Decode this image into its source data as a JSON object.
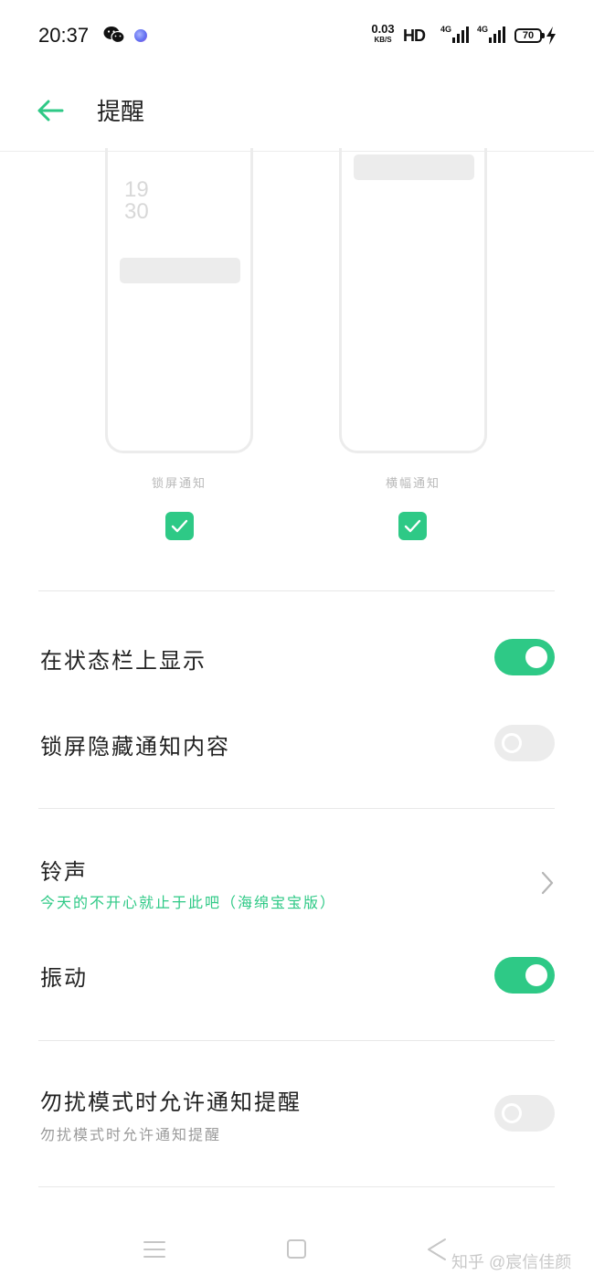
{
  "status_bar": {
    "time": "20:37",
    "net_speed_value": "0.03",
    "net_speed_unit": "KB/S",
    "hd": "HD",
    "signal_1": "4G",
    "signal_2": "4G",
    "battery": "70",
    "icons": [
      "wechat-icon",
      "assistant-icon",
      "signal-icon",
      "battery-icon",
      "charging-bolt-icon"
    ]
  },
  "header": {
    "title": "提醒",
    "back_icon": "arrow-left-icon"
  },
  "previews": {
    "lock_screen": {
      "clock_hour": "19",
      "clock_minute": "30",
      "caption": "锁屏通知",
      "checked": true
    },
    "banner": {
      "caption": "横幅通知",
      "checked": true
    }
  },
  "settings": [
    {
      "label": "在状态栏上显示",
      "toggle": true
    },
    {
      "label": "锁屏隐藏通知内容",
      "toggle": false
    },
    {
      "label": "铃声",
      "value": "今天的不开心就止于此吧（海绵宝宝版）",
      "chevron": true
    },
    {
      "label": "振动",
      "toggle": true
    },
    {
      "label": "勿扰模式时允许通知提醒",
      "sub": "勿扰模式时允许通知提醒",
      "toggle": false
    }
  ],
  "nav_bar": {
    "icons": [
      "menu-icon",
      "home-icon",
      "back-triangle-icon"
    ]
  },
  "watermark": "知乎 @宸信佳颜",
  "colors": {
    "accent": "#2ec986",
    "toggle_off": "#ececec",
    "divider": "#e8e8e8"
  }
}
